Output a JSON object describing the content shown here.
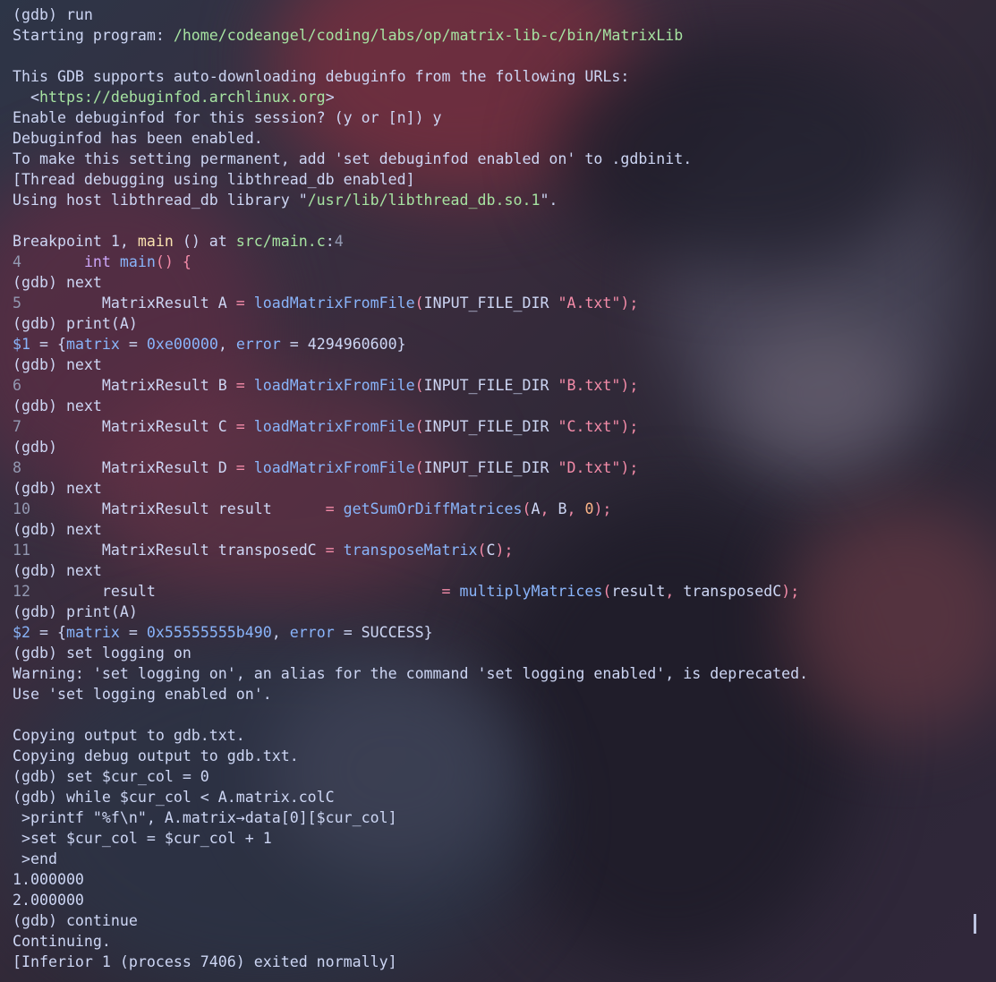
{
  "theme": {
    "default": "#cdd6f4",
    "path_green": "#a6e3a1",
    "function_yellow": "#f9e2af",
    "line_number": "#9399b2",
    "keyword": "#cba6f7",
    "string_red": "#f38ba8",
    "function_blue": "#89b4fa",
    "number_orange": "#fab387"
  },
  "terminal": {
    "lines": [
      [
        {
          "t": "(gdb) run",
          "c": "default"
        }
      ],
      [
        {
          "t": "Starting program: ",
          "c": "default"
        },
        {
          "t": "/home/codeangel/coding/labs/op/matrix-lib-c/bin/MatrixLib",
          "c": "path"
        }
      ],
      [
        {
          "t": "",
          "c": "default"
        }
      ],
      [
        {
          "t": "This GDB supports auto-downloading debuginfo from the following URLs:",
          "c": "default"
        }
      ],
      [
        {
          "t": "  <",
          "c": "default"
        },
        {
          "t": "https://debuginfod.archlinux.org",
          "c": "path"
        },
        {
          "t": ">",
          "c": "default"
        }
      ],
      [
        {
          "t": "Enable debuginfod for this session? (y or [n]) y",
          "c": "default"
        }
      ],
      [
        {
          "t": "Debuginfod has been enabled.",
          "c": "default"
        }
      ],
      [
        {
          "t": "To make this setting permanent, add 'set debuginfod enabled on' to .gdbinit.",
          "c": "default"
        }
      ],
      [
        {
          "t": "[Thread debugging using libthread_db enabled]",
          "c": "default"
        }
      ],
      [
        {
          "t": "Using host libthread_db library \"",
          "c": "default"
        },
        {
          "t": "/usr/lib/libthread_db.so.1",
          "c": "path"
        },
        {
          "t": "\".",
          "c": "default"
        }
      ],
      [
        {
          "t": "",
          "c": "default"
        }
      ],
      [
        {
          "t": "Breakpoint 1, ",
          "c": "default"
        },
        {
          "t": "main",
          "c": "fnyellow"
        },
        {
          "t": " () at ",
          "c": "default"
        },
        {
          "t": "src/main.c",
          "c": "path"
        },
        {
          "t": ":",
          "c": "default"
        },
        {
          "t": "4",
          "c": "ln"
        }
      ],
      [
        {
          "t": "4",
          "c": "ln"
        },
        {
          "t": "       ",
          "c": "default"
        },
        {
          "t": "int",
          "c": "kw"
        },
        {
          "t": " main",
          "c": "fn"
        },
        {
          "t": "() {",
          "c": "punc"
        }
      ],
      [
        {
          "t": "(gdb) next",
          "c": "default"
        }
      ],
      [
        {
          "t": "5",
          "c": "ln"
        },
        {
          "t": "         MatrixResult A ",
          "c": "default"
        },
        {
          "t": "=",
          "c": "punc"
        },
        {
          "t": " loadMatrixFromFile",
          "c": "fn"
        },
        {
          "t": "(",
          "c": "punc"
        },
        {
          "t": "INPUT_FILE_DIR ",
          "c": "default"
        },
        {
          "t": "\"A.txt\"",
          "c": "str"
        },
        {
          "t": ");",
          "c": "punc"
        }
      ],
      [
        {
          "t": "(gdb) print(A)",
          "c": "default"
        }
      ],
      [
        {
          "t": "$1",
          "c": "fn"
        },
        {
          "t": " = {",
          "c": "default"
        },
        {
          "t": "matrix",
          "c": "fn"
        },
        {
          "t": " = ",
          "c": "default"
        },
        {
          "t": "0xe00000",
          "c": "fn"
        },
        {
          "t": ", ",
          "c": "default"
        },
        {
          "t": "error",
          "c": "fn"
        },
        {
          "t": " = 4294960600}",
          "c": "default"
        }
      ],
      [
        {
          "t": "(gdb) next",
          "c": "default"
        }
      ],
      [
        {
          "t": "6",
          "c": "ln"
        },
        {
          "t": "         MatrixResult B ",
          "c": "default"
        },
        {
          "t": "=",
          "c": "punc"
        },
        {
          "t": " loadMatrixFromFile",
          "c": "fn"
        },
        {
          "t": "(",
          "c": "punc"
        },
        {
          "t": "INPUT_FILE_DIR ",
          "c": "default"
        },
        {
          "t": "\"B.txt\"",
          "c": "str"
        },
        {
          "t": ");",
          "c": "punc"
        }
      ],
      [
        {
          "t": "(gdb) next",
          "c": "default"
        }
      ],
      [
        {
          "t": "7",
          "c": "ln"
        },
        {
          "t": "         MatrixResult C ",
          "c": "default"
        },
        {
          "t": "=",
          "c": "punc"
        },
        {
          "t": " loadMatrixFromFile",
          "c": "fn"
        },
        {
          "t": "(",
          "c": "punc"
        },
        {
          "t": "INPUT_FILE_DIR ",
          "c": "default"
        },
        {
          "t": "\"C.txt\"",
          "c": "str"
        },
        {
          "t": ");",
          "c": "punc"
        }
      ],
      [
        {
          "t": "(gdb)",
          "c": "default"
        }
      ],
      [
        {
          "t": "8",
          "c": "ln"
        },
        {
          "t": "         MatrixResult D ",
          "c": "default"
        },
        {
          "t": "=",
          "c": "punc"
        },
        {
          "t": " loadMatrixFromFile",
          "c": "fn"
        },
        {
          "t": "(",
          "c": "punc"
        },
        {
          "t": "INPUT_FILE_DIR ",
          "c": "default"
        },
        {
          "t": "\"D.txt\"",
          "c": "str"
        },
        {
          "t": ");",
          "c": "punc"
        }
      ],
      [
        {
          "t": "(gdb) next",
          "c": "default"
        }
      ],
      [
        {
          "t": "10",
          "c": "ln"
        },
        {
          "t": "        MatrixResult result      ",
          "c": "default"
        },
        {
          "t": "=",
          "c": "punc"
        },
        {
          "t": " getSumOrDiffMatrices",
          "c": "fn"
        },
        {
          "t": "(",
          "c": "punc"
        },
        {
          "t": "A",
          "c": "default"
        },
        {
          "t": ",",
          "c": "punc"
        },
        {
          "t": " B",
          "c": "default"
        },
        {
          "t": ",",
          "c": "punc"
        },
        {
          "t": " 0",
          "c": "num"
        },
        {
          "t": ");",
          "c": "punc"
        }
      ],
      [
        {
          "t": "(gdb) next",
          "c": "default"
        }
      ],
      [
        {
          "t": "11",
          "c": "ln"
        },
        {
          "t": "        MatrixResult transposedC ",
          "c": "default"
        },
        {
          "t": "=",
          "c": "punc"
        },
        {
          "t": " transposeMatrix",
          "c": "fn"
        },
        {
          "t": "(",
          "c": "punc"
        },
        {
          "t": "C",
          "c": "default"
        },
        {
          "t": ");",
          "c": "punc"
        }
      ],
      [
        {
          "t": "(gdb) next",
          "c": "default"
        }
      ],
      [
        {
          "t": "12",
          "c": "ln"
        },
        {
          "t": "        result                                ",
          "c": "default"
        },
        {
          "t": "=",
          "c": "punc"
        },
        {
          "t": " multiplyMatrices",
          "c": "fn"
        },
        {
          "t": "(",
          "c": "punc"
        },
        {
          "t": "result",
          "c": "default"
        },
        {
          "t": ",",
          "c": "punc"
        },
        {
          "t": " transposedC",
          "c": "default"
        },
        {
          "t": ");",
          "c": "punc"
        }
      ],
      [
        {
          "t": "(gdb) print(A)",
          "c": "default"
        }
      ],
      [
        {
          "t": "$2",
          "c": "fn"
        },
        {
          "t": " = {",
          "c": "default"
        },
        {
          "t": "matrix",
          "c": "fn"
        },
        {
          "t": " = ",
          "c": "default"
        },
        {
          "t": "0x55555555b490",
          "c": "fn"
        },
        {
          "t": ", ",
          "c": "default"
        },
        {
          "t": "error",
          "c": "fn"
        },
        {
          "t": " = SUCCESS}",
          "c": "default"
        }
      ],
      [
        {
          "t": "(gdb) set logging on",
          "c": "default"
        }
      ],
      [
        {
          "t": "Warning: 'set logging on', an alias for the command 'set logging enabled', is deprecated.",
          "c": "default"
        }
      ],
      [
        {
          "t": "Use 'set logging enabled on'.",
          "c": "default"
        }
      ],
      [
        {
          "t": "",
          "c": "default"
        }
      ],
      [
        {
          "t": "Copying output to gdb.txt.",
          "c": "default"
        }
      ],
      [
        {
          "t": "Copying debug output to gdb.txt.",
          "c": "default"
        }
      ],
      [
        {
          "t": "(gdb) set $cur_col = 0",
          "c": "default"
        }
      ],
      [
        {
          "t": "(gdb) while $cur_col < A.matrix.colC",
          "c": "default"
        }
      ],
      [
        {
          "t": " >printf \"%f\\n\", A.matrix→data[0][$cur_col]",
          "c": "default"
        }
      ],
      [
        {
          "t": " >set $cur_col = $cur_col + 1",
          "c": "default"
        }
      ],
      [
        {
          "t": " >end",
          "c": "default"
        }
      ],
      [
        {
          "t": "1.000000",
          "c": "default"
        }
      ],
      [
        {
          "t": "2.000000",
          "c": "default"
        }
      ],
      [
        {
          "t": "(gdb) continue",
          "c": "default"
        }
      ],
      [
        {
          "t": "Continuing.",
          "c": "default"
        }
      ],
      [
        {
          "t": "[Inferior 1 (process 7406) exited normally]",
          "c": "default"
        }
      ]
    ]
  }
}
